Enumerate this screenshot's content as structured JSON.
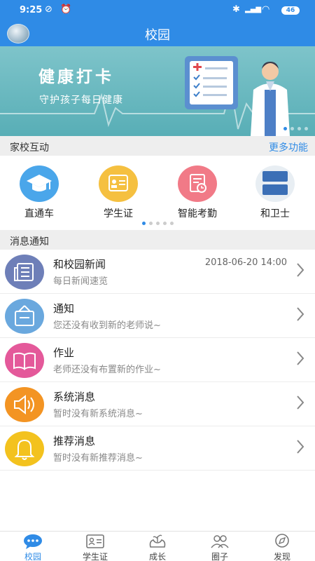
{
  "status_bar": {
    "time": "9:25",
    "battery": "46"
  },
  "header": {
    "title": "校园"
  },
  "banner": {
    "title": "健康打卡",
    "subtitle": "守护孩子每日健康"
  },
  "interaction": {
    "label": "家校互动",
    "more_label": "更多功能",
    "items": [
      {
        "label": "直通车",
        "icon": "graduation-cap-icon",
        "color": "#4aa6ea"
      },
      {
        "label": "学生证",
        "icon": "id-card-icon",
        "color": "#f5c040"
      },
      {
        "label": "智能考勤",
        "icon": "attendance-icon",
        "color": "#f17a87"
      },
      {
        "label": "和卫士",
        "icon": "location-online-icon",
        "color": "#e8eef3"
      }
    ]
  },
  "messages": {
    "label": "消息通知",
    "items": [
      {
        "title": "和校园新闻",
        "subtitle": "每日新闻速览",
        "date": "2018-06-20 14:00",
        "icon": "newspaper-icon",
        "color": "#6e7fb8"
      },
      {
        "title": "通知",
        "subtitle": "您还没有收到新的老师说~",
        "date": "",
        "icon": "notice-board-icon",
        "color": "#6aa8de"
      },
      {
        "title": "作业",
        "subtitle": "老师还没有布置新的作业~",
        "date": "",
        "icon": "book-icon",
        "color": "#e4599a"
      },
      {
        "title": "系统消息",
        "subtitle": "暂时没有新系统消息~",
        "date": "",
        "icon": "speaker-icon",
        "color": "#f39423"
      },
      {
        "title": "推荐消息",
        "subtitle": "暂时没有新推荐消息~",
        "date": "",
        "icon": "bell-icon",
        "color": "#f3c21e"
      }
    ]
  },
  "bottom_nav": {
    "items": [
      {
        "label": "校园",
        "active": true
      },
      {
        "label": "学生证",
        "active": false
      },
      {
        "label": "成长",
        "active": false
      },
      {
        "label": "圈子",
        "active": false
      },
      {
        "label": "发现",
        "active": false
      }
    ]
  },
  "colors": {
    "primary": "#2f8be6",
    "banner": "#6bbac0"
  }
}
